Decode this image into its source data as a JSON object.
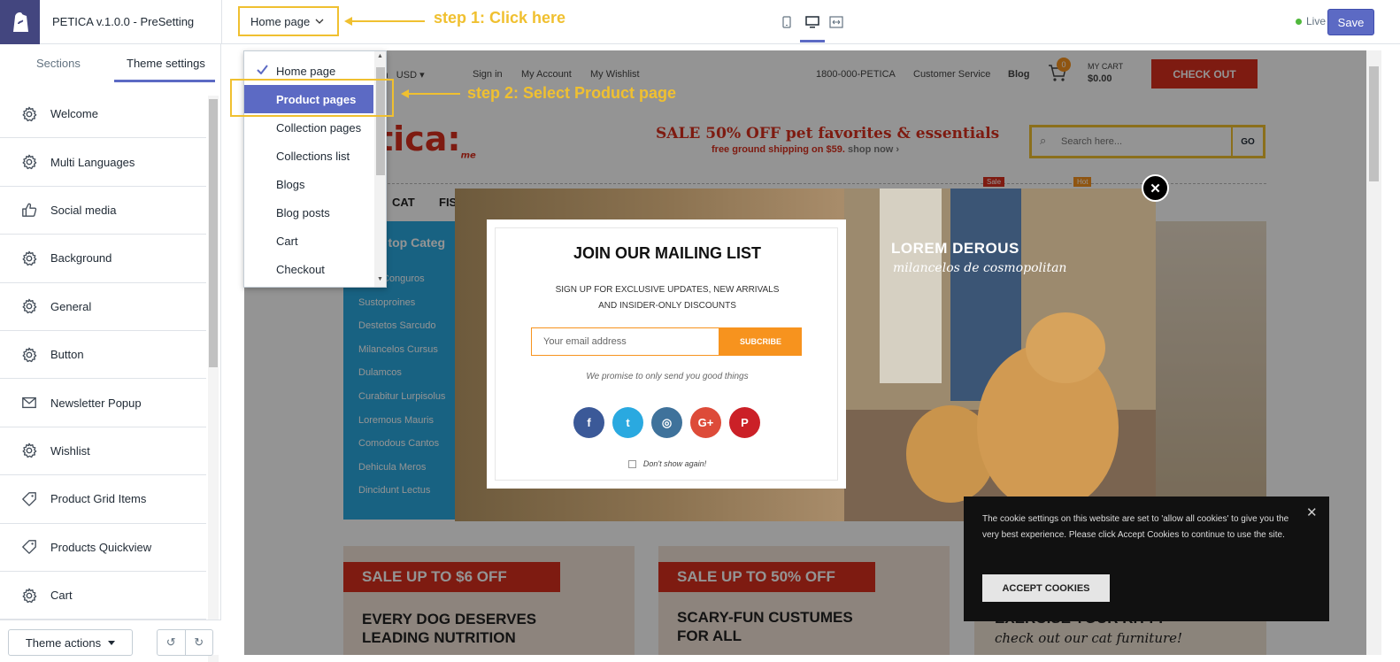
{
  "topbar": {
    "theme_name": "PETICA v.1.0.0 - PreSetting",
    "page_select": "Home page",
    "step1": "step 1: Click here",
    "step2": "step 2: Select Product page",
    "live_label": "Live",
    "save_label": "Save"
  },
  "sidebar": {
    "tabs": [
      "Sections",
      "Theme settings"
    ],
    "items": [
      {
        "label": "Welcome",
        "icon": "gear-icon"
      },
      {
        "label": "Multi Languages",
        "icon": "gear-icon"
      },
      {
        "label": "Social media",
        "icon": "thumbs-up-icon"
      },
      {
        "label": "Background",
        "icon": "gear-icon"
      },
      {
        "label": "General",
        "icon": "gear-icon"
      },
      {
        "label": "Button",
        "icon": "gear-icon"
      },
      {
        "label": "Newsletter Popup",
        "icon": "envelope-icon"
      },
      {
        "label": "Wishlist",
        "icon": "gear-icon"
      },
      {
        "label": "Product Grid Items",
        "icon": "tag-icon"
      },
      {
        "label": "Products Quickview",
        "icon": "tag-icon"
      },
      {
        "label": "Cart",
        "icon": "gear-icon"
      }
    ],
    "theme_actions": "Theme actions"
  },
  "dropdown": {
    "items": [
      "Home page",
      "Product pages",
      "Collection pages",
      "Collections list",
      "Blogs",
      "Blog posts",
      "Cart",
      "Checkout"
    ],
    "checked": "Home page",
    "highlighted": "Product pages"
  },
  "preview": {
    "topnav": [
      "sh",
      "USD",
      "Sign in",
      "My Account",
      "My Wishlist",
      "1800-000-PETICA",
      "Customer Service",
      "Blog"
    ],
    "cart_count": "0",
    "cart_label": "MY CART",
    "cart_total": "$0.00",
    "checkout": "CHECK OUT",
    "logo_text": "tica:",
    "logo_me": "me",
    "sale_headline": "SALE 50% OFF pet favorites & essentials",
    "sale_sub": "free ground shipping on $59.",
    "shop_now": "shop now ›",
    "search_placeholder": "Search here...",
    "go": "GO",
    "nav": [
      "CAT",
      "FIS"
    ],
    "badges": [
      "Sale",
      "Hot"
    ],
    "category_title": "p top Categ",
    "categories": [
      "enas Conguros",
      "Sustoproines",
      "Destetos Sarcudo",
      "Milancelos Cursus",
      "Dulamcos",
      "Curabitur Lurpisolus",
      "Loremous Mauris",
      "Comodous Cantos",
      "Dehicula Meros",
      "Dincidunt Lectus"
    ],
    "promo1_sale": "SALE UP TO $6 OFF",
    "promo1_title": "EVERY DOG DESERVES LEADING NUTRITION",
    "promo2_sale": "SALE UP TO 50% OFF",
    "promo2_title": "SCARY-FUN CUSTUMES FOR ALL",
    "promo3_title": "EXERCISE YOUR KITTY",
    "promo3_sub": "check out our cat furniture!"
  },
  "popup": {
    "title": "JOIN OUR MAILING LIST",
    "sub1": "SIGN UP FOR EXCLUSIVE UPDATES, NEW ARRIVALS",
    "sub2": "AND INSIDER-ONLY DISCOUNTS",
    "email_placeholder": "Your email address",
    "subscribe": "SUBCRIBE",
    "promise": "We promise to only send you good things",
    "noshow": "Don't show again!",
    "lorem": "LOREM DEROUS",
    "lorem_sub": "milancelos de cosmopolitan",
    "socials": [
      "facebook-icon",
      "twitter-icon",
      "instagram-icon",
      "google-plus-icon",
      "pinterest-icon"
    ],
    "social_colors": [
      "#3b5998",
      "#2aa9e0",
      "#3f729b",
      "#dd4b39",
      "#cb2027"
    ]
  },
  "cookie": {
    "text": "The cookie settings on this website are set to 'allow all cookies' to give you the very best experience. Please click Accept Cookies to continue to use the site.",
    "button": "ACCEPT COOKIES"
  },
  "colors": {
    "accent": "#5c6ac4",
    "step": "#f0c030",
    "subscribe": "#f7931e"
  }
}
